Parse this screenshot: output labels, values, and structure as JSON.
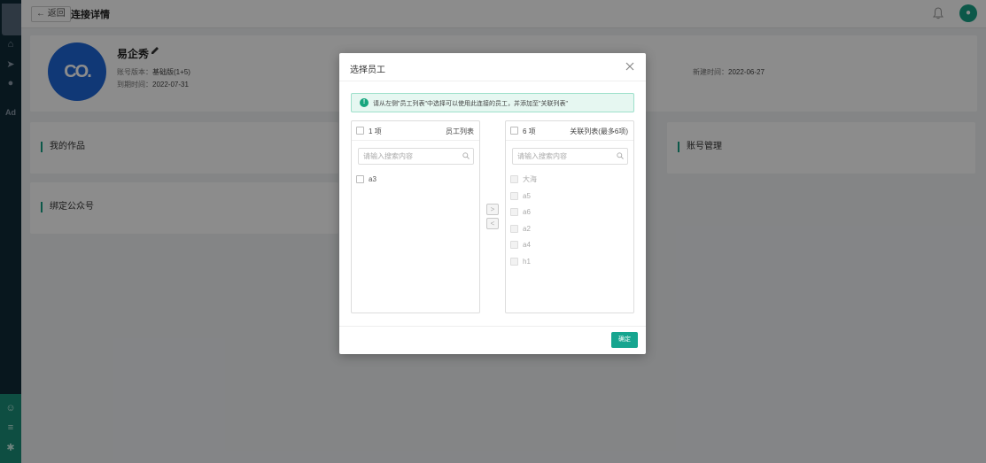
{
  "sidebar": {
    "icons": [
      "home-icon",
      "send-icon",
      "user-icon",
      "ad-icon",
      "robot-icon",
      "menu-icon",
      "gear-icon"
    ],
    "ad_label": "Ad"
  },
  "topbar": {
    "back_label": "← 返回",
    "title": "连接详情"
  },
  "profile": {
    "name": "易企秀",
    "version_label": "账号版本：",
    "version_value": "基础版(1+5)",
    "expire_label": "到期时间：",
    "expire_value": "2022-07-31",
    "created_label": "新建时间：",
    "created_value": "2022-06-27"
  },
  "sections": {
    "works": "我的作品",
    "account": "账号管理",
    "wechat": "绑定公众号"
  },
  "modal": {
    "title": "选择员工",
    "alert": "请从左侧\"员工列表\"中选择可以使用此连接的员工，并添加至\"关联列表\"",
    "left": {
      "count": "1 项",
      "title": "员工列表",
      "search_placeholder": "请输入搜索内容",
      "items": [
        "a3"
      ]
    },
    "right": {
      "count": "6 项",
      "title": "关联列表(最多6项)",
      "search_placeholder": "请输入搜索内容",
      "items": [
        "大海",
        "a5",
        "a6",
        "a2",
        "a4",
        "h1"
      ]
    },
    "arrow_right": ">",
    "arrow_left": "<",
    "confirm": "确定"
  }
}
